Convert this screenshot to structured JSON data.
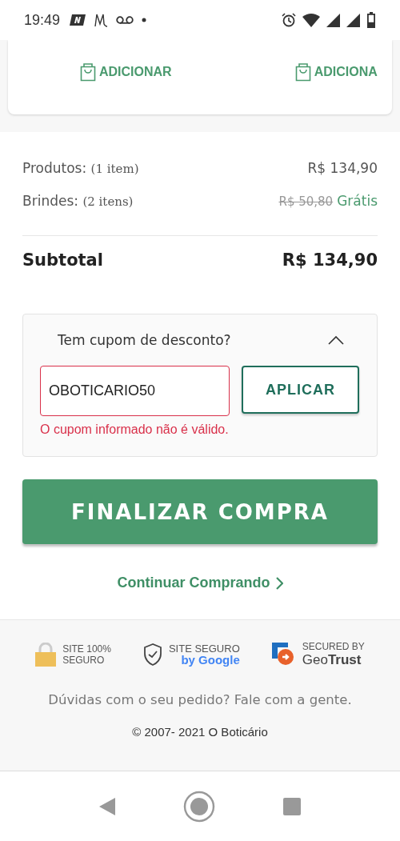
{
  "status_bar": {
    "time": "19:49"
  },
  "product_carousel": {
    "add_buttons": [
      "ADICIONAR",
      "ADICIONA"
    ]
  },
  "summary": {
    "rows": [
      {
        "kind": "price",
        "label": "Produtos:",
        "count": "(1 item)",
        "value": "R$ 134,90"
      },
      {
        "kind": "gift",
        "label": "Brindes:",
        "count": "(2 itens)",
        "old_value": "R$ 50,80",
        "value": "Grátis"
      }
    ],
    "subtotal": {
      "label": "Subtotal",
      "value": "R$ 134,90"
    }
  },
  "coupon": {
    "title": "Tem cupom de desconto?",
    "expanded": true,
    "value": "OBOTICARIO50",
    "error": "O cupom informado não é válido.",
    "apply_button": "APLICAR"
  },
  "checkout_button": "FINALIZAR COMPRA",
  "continue_link": "Continuar Comprando",
  "footer": {
    "badges": [
      {
        "kind": "lock",
        "lines": [
          "SITE 100%",
          "SEGURO"
        ]
      },
      {
        "kind": "shield",
        "lines": [
          "SITE SEGURO",
          "by Google"
        ]
      },
      {
        "kind": "geotrust",
        "lines": [
          "SECURED BY",
          "Geo**Trust**"
        ]
      }
    ],
    "help_text": "Dúvidas com o seu pedido? Fale com a gente.",
    "copyright": "© 2007- 2021 O Boticário"
  }
}
